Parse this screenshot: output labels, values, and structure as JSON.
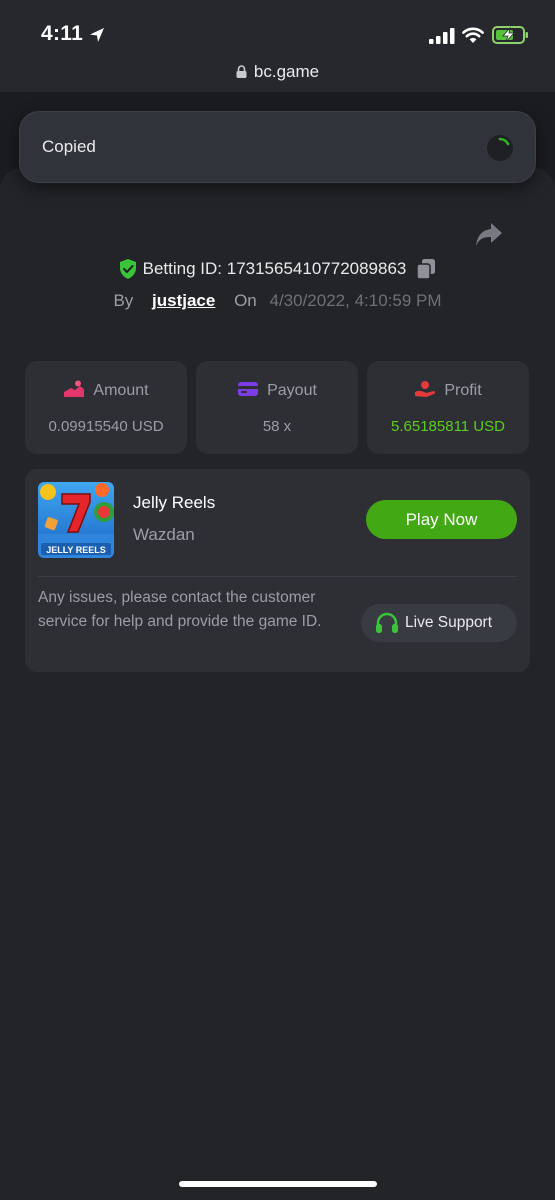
{
  "status_bar": {
    "time": "4:11"
  },
  "browser": {
    "url": "bc.game"
  },
  "toast": {
    "text": "Copied"
  },
  "bet": {
    "betting_id_label": "Betting ID:",
    "betting_id": "1731565410772089863",
    "by_label": "By",
    "username": "justjace",
    "on_label": "On",
    "datetime": "4/30/2022, 4:10:59 PM"
  },
  "stats": [
    {
      "label": "Amount",
      "value": "0.09915540 USD",
      "color": "#e2356b"
    },
    {
      "label": "Payout",
      "value": "58 x",
      "color": "#7b3ee6"
    },
    {
      "label": "Profit",
      "value": "5.65185811 USD",
      "color": "#e53a3a"
    }
  ],
  "game": {
    "name": "Jelly Reels",
    "provider": "Wazdan",
    "thumb_text": "JELLY REELS",
    "play_label": "Play Now"
  },
  "support": {
    "message": "Any issues, please contact the customer service for help and provide the game ID.",
    "button_label": "Live Support"
  },
  "colors": {
    "background": "#1b1c20",
    "card": "#2d2f35",
    "accent_green": "#42a814",
    "profit_green": "#5bcf17"
  }
}
